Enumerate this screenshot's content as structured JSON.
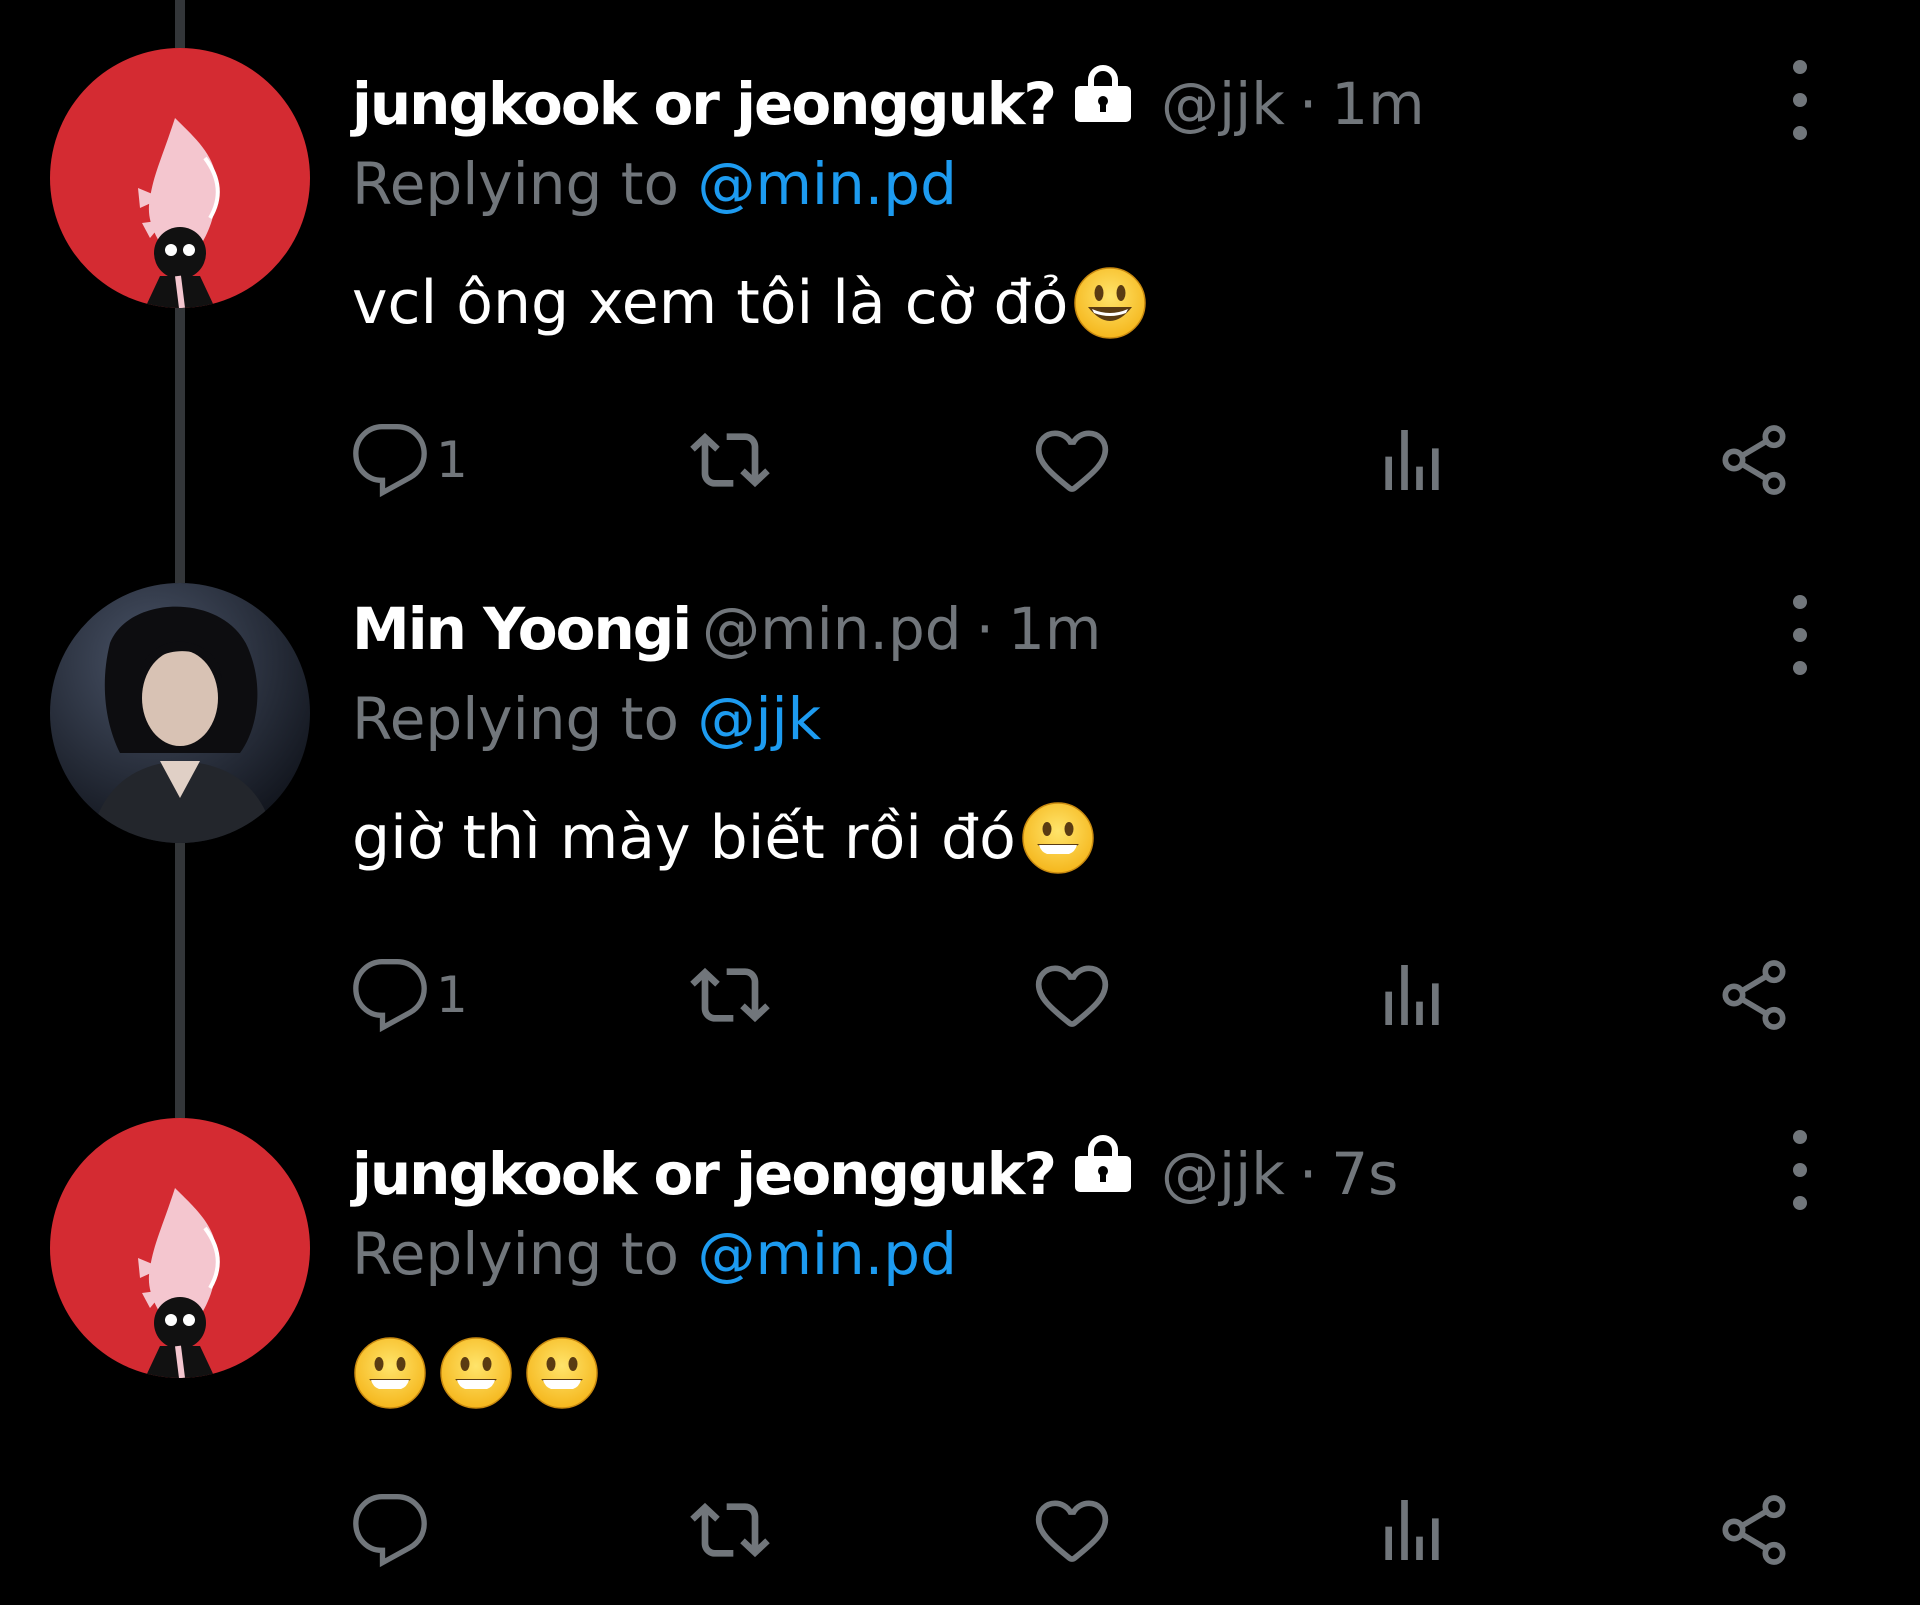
{
  "colors": {
    "background": "#000000",
    "muted": "#71767b",
    "link": "#1d9bf0",
    "thread_line": "#333639",
    "avatar_red": "#d42b32"
  },
  "replying_prefix": "Replying to ",
  "tweets": [
    {
      "name": "jungkook or jeongguk?",
      "protected_icon": "lock-icon",
      "handle": "@jjk",
      "separator": "·",
      "time": "1m",
      "reply_to": "@min.pd",
      "text": "vcl ông xem tôi là cờ đỏ",
      "emoji": [
        "smiley-emoji"
      ],
      "reply_count": "1"
    },
    {
      "name": "Min Yoongi",
      "handle": "@min.pd",
      "separator": "·",
      "time": "1m",
      "reply_to": "@jjk",
      "text": "giờ thì mày biết rồi đó",
      "emoji": [
        "grinning-emoji"
      ],
      "reply_count": "1"
    },
    {
      "name": "jungkook or jeongguk?",
      "protected_icon": "lock-icon",
      "handle": "@jjk",
      "separator": "·",
      "time": "7s",
      "reply_to": "@min.pd",
      "text": "",
      "emoji": [
        "grinning-emoji",
        "grinning-emoji",
        "grinning-emoji"
      ],
      "reply_count": ""
    }
  ],
  "action_icons": [
    "reply-icon",
    "retweet-icon",
    "like-icon",
    "views-icon",
    "share-icon"
  ]
}
